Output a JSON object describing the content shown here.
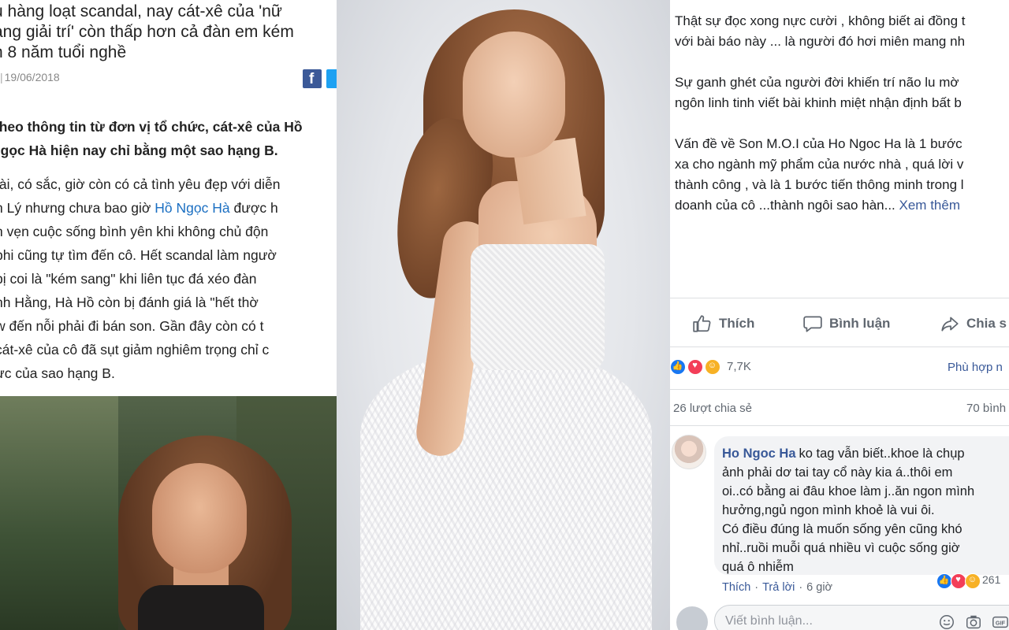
{
  "article": {
    "headline_lines": [
      "u hàng loạt scandal, nay cát-xê của 'nữ",
      "àng giải trí' còn thấp hơn cả đàn em kém",
      "n 8 năm tuổi nghề"
    ],
    "date": "19/06/2018",
    "lead_lines": [
      "Theo thông tin từ đơn vị tổ chức, cát-xê của Hồ",
      "Ngọc Hà hiện nay chỉ bằng một sao hạng B."
    ],
    "body_lines": [
      {
        "pre": "tài, có sắc, giờ còn có cả tình yêu đẹp với diễn",
        "link": "",
        "post": ""
      },
      {
        "pre": "n Lý nhưng chưa bao giờ ",
        "link": "Hồ Ngọc Hà",
        "post": " được h"
      },
      {
        "pre": "n vẹn cuộc sống bình yên khi không chủ độn",
        "link": "",
        "post": ""
      },
      {
        "pre": "phi cũng tự tìm đến cô. Hết scandal làm ngườ",
        "link": "",
        "post": ""
      },
      {
        "pre": " bị coi là \"kém sang\" khi liên tục đá xéo đàn",
        "link": "",
        "post": ""
      },
      {
        "pre": "nh Hằng, Hà Hồ còn bị đánh giá là \"hết thờ",
        "link": "",
        "post": ""
      },
      {
        "pre": "w đến nỗi phải đi bán son. Gần đây còn có t",
        "link": "",
        "post": ""
      },
      {
        "pre": " cát-xê của cô đã sụt giảm nghiêm trọng chỉ c",
        "link": "",
        "post": ""
      },
      {
        "pre": "ực của sao hạng B.",
        "link": "",
        "post": ""
      }
    ]
  },
  "post": {
    "paragraphs": [
      [
        "Thật sự đọc xong nực cười , không biết ai đồng t",
        "với bài báo này ... là người đó hơi miên mang nh"
      ],
      [
        "Sự ganh ghét của người đời khiến trí não lu mờ",
        "ngôn linh tinh viết bài khinh miệt nhận định bất b"
      ],
      [
        "Vấn đề về Son M.O.I của Ho Ngoc Ha là 1 bước",
        "xa cho ngành mỹ phẩm của nước nhà , quá lời v",
        "thành công , và là 1 bước tiến thông minh trong l"
      ]
    ],
    "last_line": "doanh của cô ...thành ngôi sao hàn...",
    "see_more": "Xem thêm",
    "actions": {
      "like": "Thích",
      "comment": "Bình luận",
      "share": "Chia s"
    },
    "reaction_count": "7,7K",
    "relevant": "Phù hợp n",
    "shares": "26 lượt chia sẻ",
    "comments_count": "70 bình",
    "comment": {
      "author": "Ho Ngoc Ha",
      "lines": [
        "ko tag vẫn biết..khoe là chụp",
        "ảnh phải dơ tai tay cổ này kia á..thôi em",
        "oi..có bằng ai đâu khoe làm j..ăn ngon mình",
        "hưởng,ngủ ngon mình khoẻ là vui ôi.",
        "Có điều đúng là muốn sống yên cũng khó",
        "nhỉ..ruồi muỗi quá nhiều vì cuộc sống giờ",
        "quá ô nhiễm"
      ],
      "like": "Thích",
      "reply": "Trả lời",
      "time": "6 giờ",
      "reaction_count": "261"
    },
    "write_placeholder": "Viết bình luận..."
  },
  "colors": {
    "facebook_blue": "#3b5998",
    "link_blue": "#385898",
    "like_blue": "#1877f2",
    "love_red": "#f33e58",
    "haha_yellow": "#f7b125"
  }
}
